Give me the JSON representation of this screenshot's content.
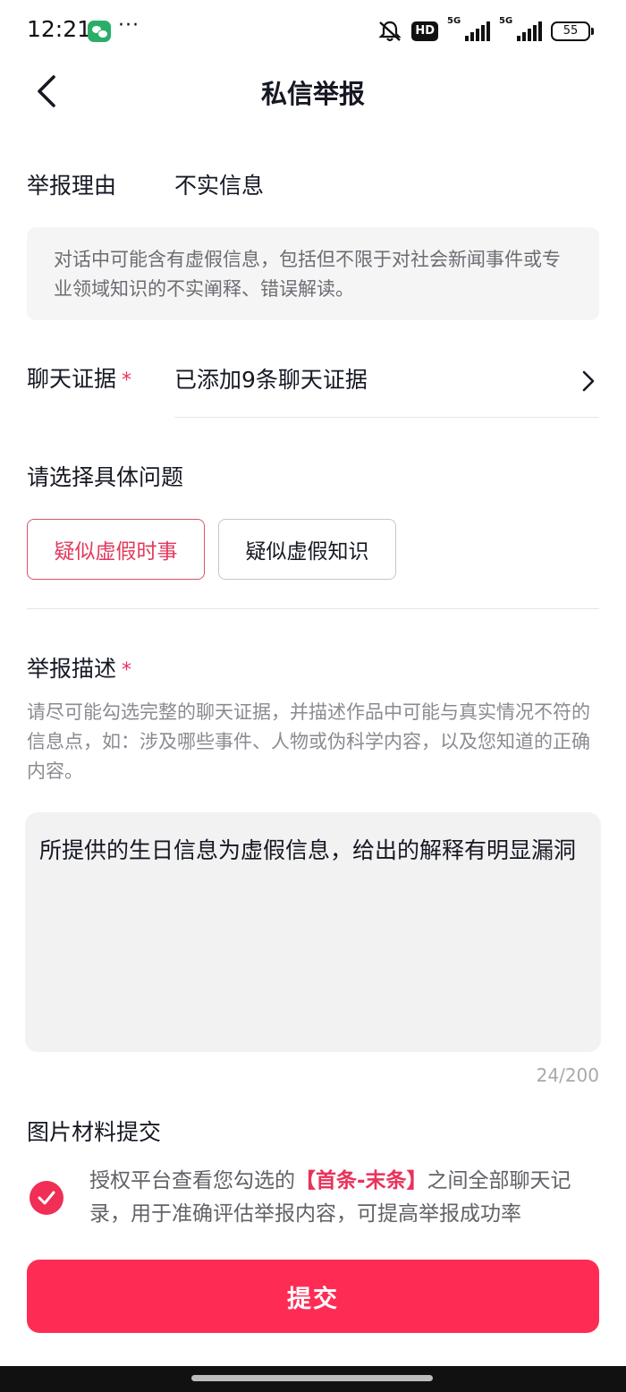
{
  "status_bar": {
    "time": "12:21",
    "more": "···",
    "hd": "HD",
    "net1": "5G",
    "net2": "5G",
    "battery": "55"
  },
  "header": {
    "title": "私信举报"
  },
  "reason": {
    "label": "举报理由",
    "value": "不实信息",
    "description": "对话中可能含有虚假信息，包括但不限于对社会新闻事件或专业领域知识的不实阐释、错误解读。"
  },
  "evidence": {
    "label": "聊天证据",
    "required_mark": "*",
    "value": "已添加9条聊天证据"
  },
  "issue": {
    "label": "请选择具体问题",
    "options": [
      {
        "label": "疑似虚假时事",
        "selected": true
      },
      {
        "label": "疑似虚假知识",
        "selected": false
      }
    ]
  },
  "description": {
    "label": "举报描述",
    "required_mark": "*",
    "hint": "请尽可能勾选完整的聊天证据，并描述作品中可能与真实情况不符的信息点，如：涉及哪些事件、人物或伪科学内容，以及您知道的正确内容。",
    "value": "所提供的生日信息为虚假信息，给出的解释有明显漏洞",
    "counter": "24/200"
  },
  "images": {
    "label": "图片材料提交"
  },
  "authorization": {
    "checked": true,
    "text_before": "授权平台查看您勾选的",
    "highlight": "【首条-末条】",
    "text_after": "之间全部聊天记录，用于准确评估举报内容，可提高举报成功率"
  },
  "submit": {
    "label": "提交"
  },
  "colors": {
    "accent": "#fe2c55",
    "star": "#e8325a",
    "selected_text": "#e23a5c"
  }
}
